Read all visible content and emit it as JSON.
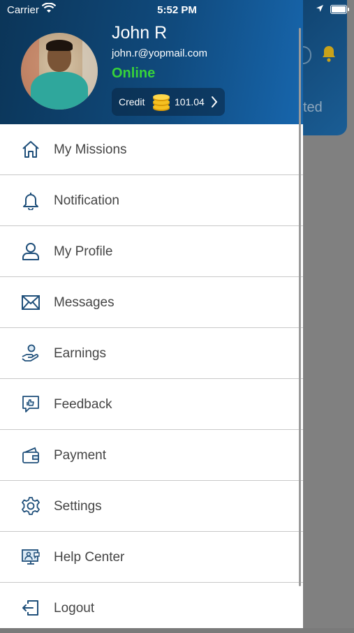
{
  "status_bar": {
    "carrier": "Carrier",
    "time": "5:52 PM"
  },
  "profile": {
    "name": "John R",
    "email": "john.r@yopmail.com",
    "status": "Online",
    "credit_label": "Credit",
    "credit_amount": "101.04"
  },
  "menu": {
    "items": [
      {
        "label": "My Missions",
        "icon": "home-icon"
      },
      {
        "label": "Notification",
        "icon": "bell-icon"
      },
      {
        "label": "My Profile",
        "icon": "user-icon"
      },
      {
        "label": "Messages",
        "icon": "envelope-icon"
      },
      {
        "label": "Earnings",
        "icon": "hand-coin-icon"
      },
      {
        "label": "Feedback",
        "icon": "feedback-icon"
      },
      {
        "label": "Payment",
        "icon": "wallet-icon"
      },
      {
        "label": "Settings",
        "icon": "gear-icon"
      },
      {
        "label": "Help Center",
        "icon": "help-center-icon"
      },
      {
        "label": "Logout",
        "icon": "logout-icon"
      }
    ]
  },
  "background": {
    "partial_text": "ted"
  },
  "colors": {
    "header_start": "#0b3558",
    "header_end": "#1766ad",
    "online": "#37d33a",
    "icon": "#1f4f7a",
    "text": "#444444"
  }
}
